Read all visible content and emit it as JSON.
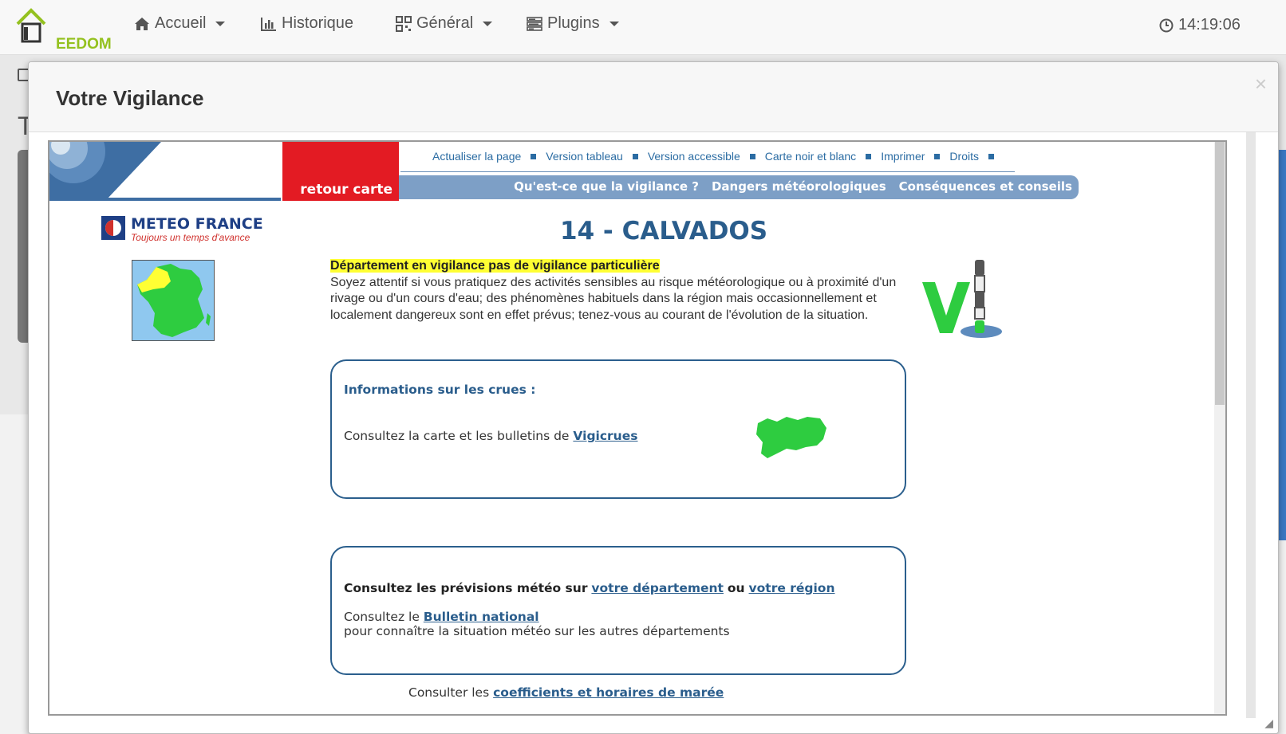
{
  "app": {
    "logo_text": "EEDOM",
    "nav": [
      {
        "label": "Accueil",
        "icon": "home-icon",
        "dropdown": true
      },
      {
        "label": "Historique",
        "icon": "bar-chart-icon",
        "dropdown": false
      },
      {
        "label": "Général",
        "icon": "qrcode-icon",
        "dropdown": true
      },
      {
        "label": "Plugins",
        "icon": "tasks-icon",
        "dropdown": true
      }
    ],
    "clock": "14:19:06",
    "background_letter": "T"
  },
  "modal": {
    "title": "Votre Vigilance",
    "close_symbol": "×"
  },
  "meteo": {
    "return_label": "retour carte",
    "top_links": [
      "Actualiser la page",
      "Version tableau",
      "Version accessible",
      "Carte noir et blanc",
      "Imprimer",
      "Droits"
    ],
    "menu": [
      "Qu'est-ce que la vigilance ?",
      "Dangers météorologiques",
      "Conséquences et conseils"
    ],
    "brand_name": "METEO FRANCE",
    "brand_tagline": "Toujours un temps d'avance",
    "department_title": "14 - CALVADOS",
    "vigilance_headline": "Département en vigilance pas de vigilance particulière",
    "vigilance_text": "Soyez attentif si vous pratiquez des activités sensibles au risque météorologique ou à proximité d'un rivage ou d'un cours d'eau; des phénomènes habituels dans la région mais occasionnellement et localement dangereux sont en effet prévus; tenez-vous au courant de l'évolution de la situation.",
    "crues": {
      "heading": "Informations sur les crues :",
      "text": "Consultez la carte et les bulletins de",
      "link": "Vigicrues"
    },
    "previsions": {
      "lead": "Consultez les prévisions météo sur",
      "link_departement": "votre département",
      "or": "ou",
      "link_region": "votre région",
      "bulletin_prefix": "Consultez le",
      "bulletin_link": "Bulletin national",
      "bulletin_suffix": "pour connaître la situation météo sur les autres départements"
    },
    "maree": {
      "prefix": "Consulter les",
      "link": "coefficients et horaires de marée"
    },
    "colors": {
      "vigilance_level": "#2ecc40",
      "highlight": "#ffff33",
      "accent_red": "#e31b23",
      "menu_blue": "#7d9fc6"
    }
  }
}
